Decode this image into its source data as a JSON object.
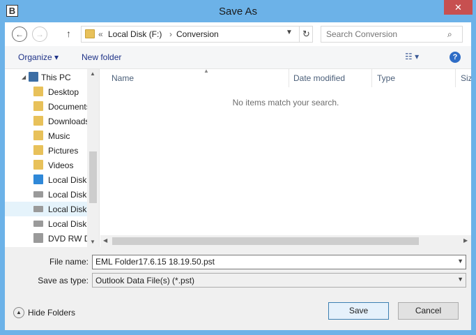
{
  "window": {
    "title": "Save As",
    "app_icon": "B",
    "close_glyph": "✕"
  },
  "nav": {
    "back_glyph": "←",
    "forward_glyph": "→",
    "up_glyph": "↑",
    "breadcrumb_prefix": "«",
    "breadcrumb": [
      "Local Disk (F:)",
      "Conversion"
    ],
    "separator": "›",
    "refresh_glyph": "↻",
    "search_placeholder": "Search Conversion",
    "search_glyph": "⌕"
  },
  "toolbar": {
    "organize": "Organize ▾",
    "new_folder": "New folder",
    "view_glyph": "☷ ▾",
    "help_glyph": "?"
  },
  "tree": {
    "items": [
      {
        "label": "This PC",
        "icon": "computer-icon",
        "color": "#3c6ea5"
      },
      {
        "label": "Desktop",
        "icon": "desktop-folder-icon",
        "color": "#e8c15a"
      },
      {
        "label": "Documents",
        "icon": "documents-folder-icon",
        "color": "#e8c15a"
      },
      {
        "label": "Downloads",
        "icon": "downloads-folder-icon",
        "color": "#e8c15a"
      },
      {
        "label": "Music",
        "icon": "music-folder-icon",
        "color": "#e8c15a"
      },
      {
        "label": "Pictures",
        "icon": "pictures-folder-icon",
        "color": "#e8c15a"
      },
      {
        "label": "Videos",
        "icon": "videos-folder-icon",
        "color": "#e8c15a"
      },
      {
        "label": "Local Disk",
        "icon": "windows-drive-icon",
        "color": "#2f88d8"
      },
      {
        "label": "Local Disk",
        "icon": "drive-icon",
        "color": "#9a9a9a"
      },
      {
        "label": "Local Disk",
        "icon": "drive-icon",
        "color": "#9a9a9a"
      },
      {
        "label": "Local Disk",
        "icon": "network-drive-icon",
        "color": "#9a9a9a"
      },
      {
        "label": "DVD RW D",
        "icon": "dvd-drive-icon",
        "color": "#9a9a9a"
      }
    ],
    "selected_index": 9
  },
  "list": {
    "columns": [
      "Name",
      "Date modified",
      "Type",
      "Size"
    ],
    "empty_message": "No items match your search."
  },
  "form": {
    "file_name_label": "File name:",
    "file_name_value": "EML Folder17.6.15 18.19.50.pst",
    "save_type_label": "Save as type:",
    "save_type_value": "Outlook Data File(s) (*.pst)"
  },
  "footer": {
    "hide_folders": "Hide Folders",
    "save": "Save",
    "cancel": "Cancel"
  }
}
